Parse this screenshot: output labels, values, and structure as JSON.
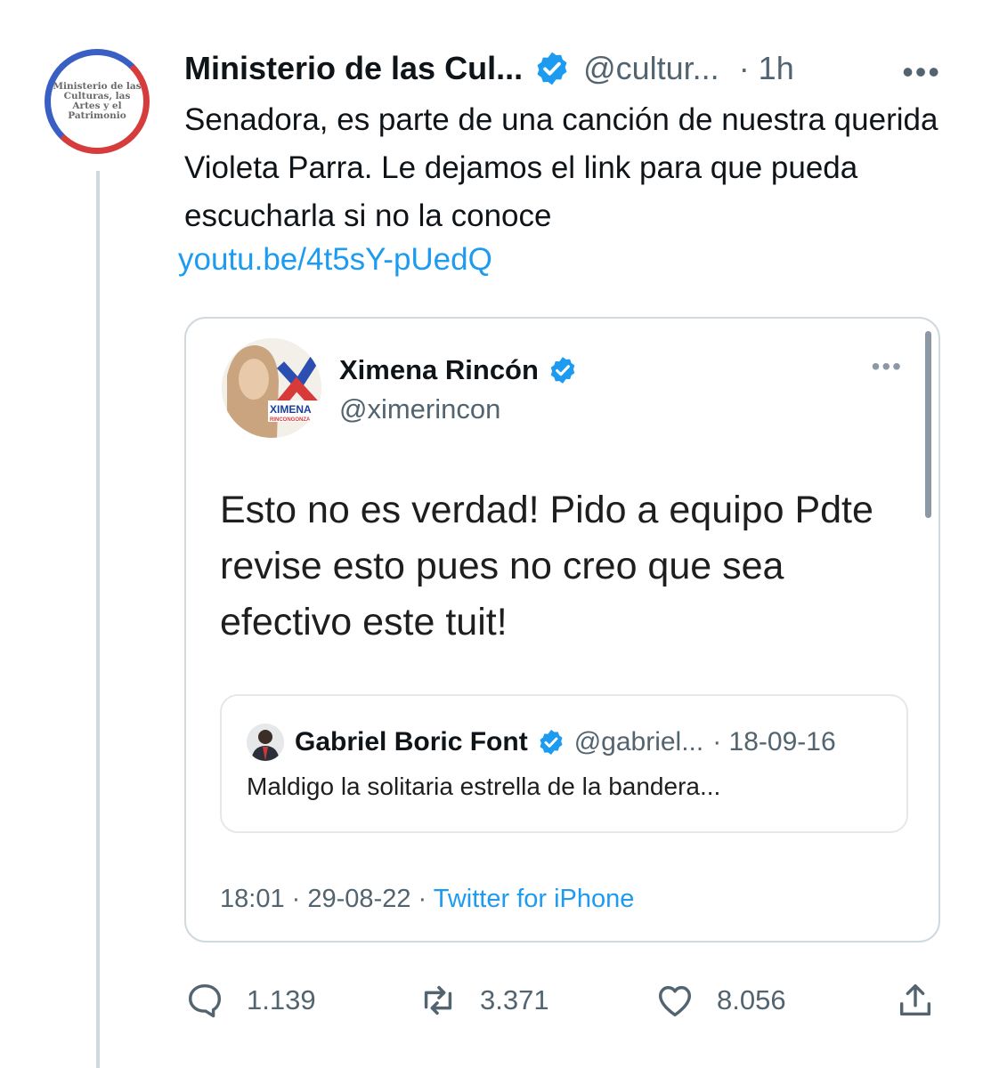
{
  "tweet": {
    "author_name": "Ministerio de las Cul...",
    "author_handle": "@cultur...",
    "time": "· 1h",
    "avatar_text": "Ministerio de las Culturas, las Artes y el Patrimonio",
    "text": "Senadora, es parte de una canción de nuestra querida Violeta Parra. Le dejamos el link para que pueda escucharla si no la conoce",
    "link": "youtu.be/4t5sY-pUedQ",
    "more_label": "•••"
  },
  "quoted": {
    "author_name": "Ximena Rincón",
    "author_handle": "@ximerincon",
    "avatar_logo_text": "XIMENA",
    "avatar_logo_subtext": "RINCONGONZA",
    "more_label": "•••",
    "text": "Esto no es verdad! Pido a equipo Pdte revise esto pues no creo que sea efectivo este tuit!",
    "time": "18:01",
    "date": "29-08-22",
    "separator": "·",
    "source": "Twitter for iPhone"
  },
  "nested_quote": {
    "author_name": "Gabriel Boric Font",
    "author_handle": "@gabriel...",
    "date": "· 18-09-16",
    "text": "Maldigo la solitaria estrella de la bandera..."
  },
  "actions": {
    "replies": "1.139",
    "retweets": "3.371",
    "likes": "8.056"
  },
  "colors": {
    "accent": "#1d9bf0",
    "muted": "#536471",
    "border": "#cfd9de"
  },
  "icons": [
    "verified-badge-icon",
    "more-icon",
    "reply-icon",
    "retweet-icon",
    "like-icon",
    "share-icon"
  ]
}
